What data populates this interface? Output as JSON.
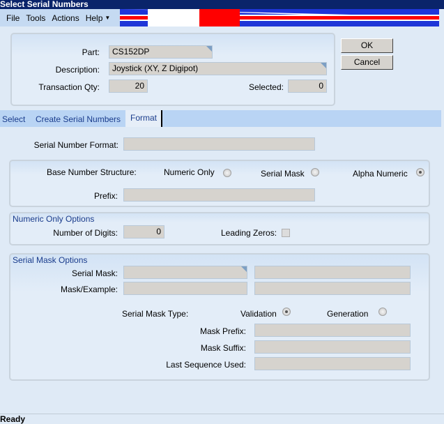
{
  "window": {
    "title": "Select Serial Numbers"
  },
  "menu": [
    "File",
    "Tools",
    "Actions",
    "Help"
  ],
  "header": {
    "part_label": "Part:",
    "part": "CS152DP",
    "description_label": "Description:",
    "description": "Joystick (XY, Z Digipot)",
    "qty_label": "Transaction Qty:",
    "qty": "20",
    "selected_label": "Selected:",
    "selected": "0"
  },
  "buttons": {
    "ok": "OK",
    "cancel": "Cancel"
  },
  "tabs": [
    "Select",
    "Create Serial Numbers",
    "Format"
  ],
  "format": {
    "serial_number_format_label": "Serial Number Format:",
    "serial_number_format": "",
    "base_structure_label": "Base Number Structure:",
    "options": [
      {
        "label": "Numeric Only",
        "checked": false
      },
      {
        "label": "Serial Mask",
        "checked": false
      },
      {
        "label": "Alpha Numeric",
        "checked": true
      }
    ],
    "prefix_label": "Prefix:",
    "prefix": ""
  },
  "numeric_options": {
    "title": "Numeric Only Options",
    "digits_label": "Number of Digits:",
    "digits": "0",
    "leading_zeros_label": "Leading Zeros:",
    "leading_zeros": false
  },
  "mask_options": {
    "title": "Serial Mask Options",
    "serial_mask_label": "Serial Mask:",
    "mask_example_label": "Mask/Example:",
    "type_label": "Serial Mask Type:",
    "validation": "Validation",
    "generation": "Generation",
    "mask_prefix_label": "Mask Prefix:",
    "mask_suffix_label": "Mask Suffix:",
    "last_seq_label": "Last Sequence Used:"
  },
  "status": "Ready"
}
